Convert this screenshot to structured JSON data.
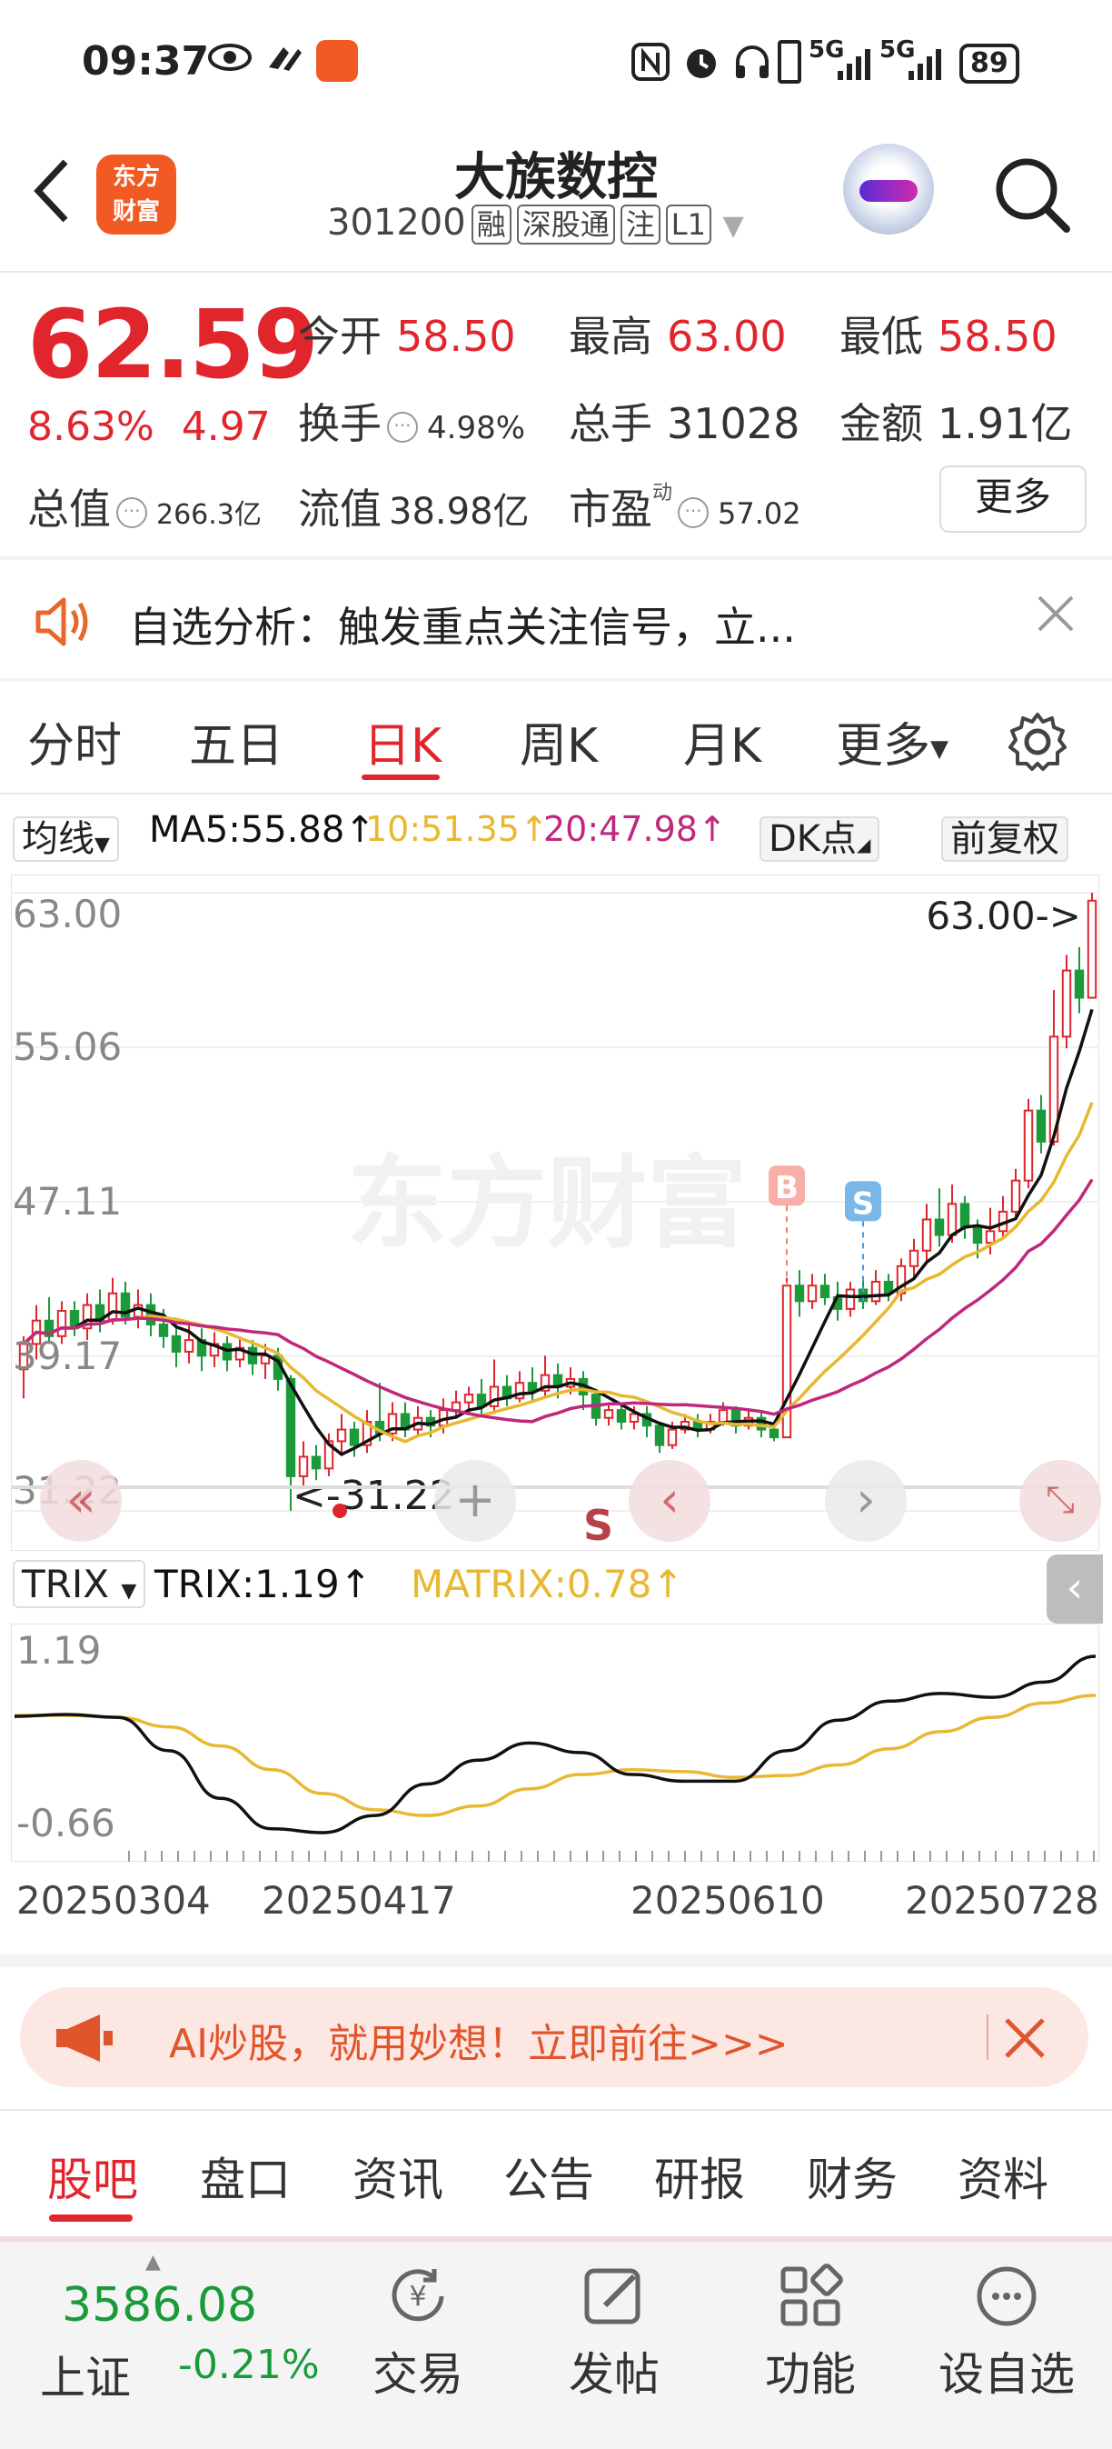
{
  "status_bar": {
    "time": "09:37",
    "network_1": "5G",
    "network_2": "5G",
    "battery": "89"
  },
  "header": {
    "title": "大族数控",
    "code": "301200",
    "tags": [
      "融",
      "深股通",
      "注",
      "L1"
    ],
    "logo_text_1": "东方",
    "logo_text_2": "财富"
  },
  "quote": {
    "price": "62.59",
    "change_pct": "8.63%",
    "change": "4.97",
    "rows": [
      [
        {
          "label": "今开",
          "value": "58.50",
          "color": "red"
        },
        {
          "label": "最高",
          "value": "63.00",
          "color": "red"
        },
        {
          "label": "最低",
          "value": "58.50",
          "color": "red"
        }
      ],
      [
        {
          "label": "换手",
          "value": "4.98%"
        },
        {
          "label": "总手",
          "value": "31028"
        },
        {
          "label": "金额",
          "value": "1.91亿"
        }
      ],
      [
        {
          "label": "总值",
          "value": "266.3亿"
        },
        {
          "label": "流值",
          "value": "38.98亿"
        },
        {
          "label": "市盈",
          "value": "57.02",
          "sup": "动"
        }
      ]
    ],
    "more": "更多"
  },
  "banner": {
    "text": "自选分析：触发重点关注信号，立..."
  },
  "tabs": [
    "分时",
    "五日",
    "日K",
    "周K",
    "月K",
    "更多",
    "⚙"
  ],
  "active_tab": "日K",
  "ma_bar": {
    "mode": "均线",
    "ma5": "MA5:55.88↑",
    "ma10": "10:51.35↑",
    "ma20": "20:47.98↑",
    "dk": "DK点",
    "adjust": "前复权"
  },
  "colors": {
    "up": "#e0262c",
    "down": "#1b9a3a",
    "ma5": "#111111",
    "ma10": "#e8b830",
    "ma20": "#c0287c",
    "trix": "#111111",
    "matrix": "#e8b830"
  },
  "kchart": {
    "y_ticks": [
      "63.00",
      "55.06",
      "47.11",
      "39.17",
      "31.22"
    ],
    "high_marker": "63.00->",
    "low_marker": "<-31.22",
    "buy_mark": "B",
    "sell_mark": "S",
    "s_label": "S",
    "watermark": "东方财富"
  },
  "trix_bar": {
    "mode": "TRIX",
    "trix": "TRIX:1.19↑",
    "matrix": "MATRIX:0.78↑"
  },
  "trix_axis": [
    "1.19",
    "-0.66"
  ],
  "x_dates": [
    "20250304",
    "20250417",
    "20250610",
    "20250728"
  ],
  "chart_data": [
    {
      "type": "candlestick",
      "title": "",
      "ylim": [
        31.22,
        63.0
      ],
      "high": 63.0,
      "low": 31.22,
      "candles": [
        [
          38.5,
          39.8,
          37.0,
          40.2
        ],
        [
          39.8,
          41.0,
          39.0,
          41.8
        ],
        [
          41.0,
          40.2,
          39.8,
          42.2
        ],
        [
          40.2,
          41.5,
          39.8,
          42.0
        ],
        [
          41.5,
          40.6,
          40.2,
          42.0
        ],
        [
          40.6,
          41.8,
          40.0,
          42.4
        ],
        [
          41.8,
          41.0,
          40.4,
          42.6
        ],
        [
          41.0,
          42.4,
          40.8,
          43.2
        ],
        [
          42.4,
          41.2,
          40.8,
          43.0
        ],
        [
          41.2,
          41.8,
          40.6,
          42.6
        ],
        [
          41.8,
          40.8,
          40.2,
          42.4
        ],
        [
          40.8,
          40.2,
          39.6,
          41.6
        ],
        [
          40.2,
          39.4,
          38.6,
          40.8
        ],
        [
          39.4,
          40.0,
          38.8,
          40.8
        ],
        [
          40.0,
          39.2,
          38.4,
          40.6
        ],
        [
          39.2,
          39.8,
          38.6,
          40.4
        ],
        [
          39.8,
          39.0,
          38.4,
          40.2
        ],
        [
          39.0,
          39.6,
          38.6,
          40.2
        ],
        [
          39.6,
          38.8,
          38.2,
          40.0
        ],
        [
          38.8,
          39.2,
          38.0,
          39.8
        ],
        [
          39.2,
          38.0,
          37.4,
          39.6
        ],
        [
          38.0,
          33.0,
          31.22,
          38.2
        ],
        [
          33.0,
          34.0,
          32.4,
          34.8
        ],
        [
          34.0,
          33.4,
          32.8,
          34.6
        ],
        [
          33.4,
          34.8,
          33.0,
          35.2
        ],
        [
          34.8,
          35.4,
          34.2,
          36.2
        ],
        [
          35.4,
          34.6,
          34.0,
          35.8
        ],
        [
          34.6,
          35.8,
          34.2,
          36.4
        ],
        [
          35.8,
          35.2,
          34.8,
          37.8
        ],
        [
          35.2,
          36.2,
          34.8,
          36.8
        ],
        [
          36.2,
          35.4,
          35.0,
          36.8
        ],
        [
          35.4,
          36.0,
          35.0,
          36.6
        ],
        [
          36.0,
          35.6,
          35.0,
          36.4
        ],
        [
          35.6,
          36.4,
          35.2,
          37.0
        ],
        [
          36.4,
          36.8,
          36.0,
          37.4
        ],
        [
          36.8,
          37.2,
          36.2,
          37.6
        ],
        [
          37.2,
          36.6,
          36.2,
          38.0
        ],
        [
          36.6,
          37.6,
          36.2,
          39.0
        ],
        [
          37.6,
          37.0,
          36.6,
          38.2
        ],
        [
          37.0,
          37.8,
          36.8,
          38.4
        ],
        [
          37.8,
          37.4,
          36.8,
          38.6
        ],
        [
          37.4,
          38.2,
          37.0,
          39.2
        ],
        [
          38.2,
          37.6,
          37.0,
          38.8
        ],
        [
          37.6,
          38.0,
          37.2,
          38.6
        ],
        [
          38.0,
          37.2,
          36.4,
          38.4
        ],
        [
          37.2,
          36.0,
          35.6,
          37.4
        ],
        [
          36.0,
          36.4,
          35.6,
          36.8
        ],
        [
          36.4,
          35.8,
          35.4,
          36.8
        ],
        [
          35.8,
          36.2,
          35.4,
          36.6
        ],
        [
          36.2,
          35.6,
          35.0,
          36.6
        ],
        [
          35.6,
          34.6,
          34.2,
          35.8
        ],
        [
          34.6,
          35.4,
          34.4,
          35.8
        ],
        [
          35.4,
          35.8,
          35.2,
          36.2
        ],
        [
          35.8,
          35.4,
          35.0,
          36.2
        ],
        [
          35.4,
          35.8,
          35.2,
          36.2
        ],
        [
          35.8,
          36.4,
          35.6,
          36.8
        ],
        [
          36.4,
          35.6,
          35.2,
          36.6
        ],
        [
          35.6,
          36.0,
          35.4,
          36.4
        ],
        [
          36.0,
          35.4,
          35.0,
          36.4
        ],
        [
          35.4,
          35.0,
          34.8,
          35.8
        ],
        [
          35.0,
          42.8,
          35.0,
          43.2
        ],
        [
          42.8,
          42.0,
          41.2,
          43.6
        ],
        [
          42.0,
          42.8,
          41.6,
          43.4
        ],
        [
          42.8,
          42.2,
          41.8,
          43.4
        ],
        [
          42.2,
          41.6,
          41.0,
          43.0
        ],
        [
          41.6,
          42.6,
          41.2,
          43.0
        ],
        [
          42.6,
          42.0,
          41.6,
          43.2
        ],
        [
          42.0,
          43.0,
          41.8,
          43.6
        ],
        [
          43.0,
          42.4,
          42.0,
          43.4
        ],
        [
          42.4,
          43.8,
          42.0,
          44.2
        ],
        [
          43.8,
          44.6,
          43.2,
          45.2
        ],
        [
          44.6,
          46.2,
          44.0,
          47.0
        ],
        [
          46.2,
          45.4,
          44.8,
          47.8
        ],
        [
          45.4,
          47.0,
          45.0,
          48.0
        ],
        [
          47.0,
          45.8,
          45.2,
          47.4
        ],
        [
          45.8,
          45.0,
          44.2,
          46.2
        ],
        [
          45.0,
          45.6,
          44.4,
          46.8
        ],
        [
          45.6,
          46.6,
          45.2,
          47.4
        ],
        [
          46.6,
          48.2,
          46.2,
          48.8
        ],
        [
          48.2,
          51.8,
          47.8,
          52.4
        ],
        [
          51.8,
          50.2,
          49.6,
          52.6
        ],
        [
          50.2,
          55.6,
          50.0,
          58.0
        ],
        [
          55.6,
          59.0,
          55.0,
          59.8
        ],
        [
          59.0,
          57.6,
          56.8,
          60.2
        ],
        [
          57.6,
          62.59,
          58.5,
          63.0
        ]
      ],
      "candle_format": [
        "open",
        "close",
        "low",
        "high"
      ],
      "series": [
        {
          "name": "MA5",
          "current": 55.88
        },
        {
          "name": "MA10",
          "current": 51.35
        },
        {
          "name": "MA20",
          "current": 47.98
        }
      ]
    },
    {
      "type": "line",
      "title": "",
      "ylim": [
        -0.66,
        1.19
      ],
      "x": [
        "20250304",
        "20250417",
        "20250610",
        "20250728"
      ],
      "series": [
        {
          "name": "TRIX",
          "values": [
            0.56,
            0.58,
            0.55,
            0.2,
            -0.3,
            -0.62,
            -0.66,
            -0.48,
            -0.15,
            0.1,
            0.28,
            0.18,
            -0.05,
            -0.12,
            -0.12,
            0.2,
            0.52,
            0.72,
            0.8,
            0.76,
            0.92,
            1.19
          ]
        },
        {
          "name": "MATRIX",
          "values": [
            0.57,
            0.57,
            0.55,
            0.45,
            0.25,
            0.0,
            -0.25,
            -0.42,
            -0.48,
            -0.38,
            -0.2,
            -0.05,
            0.0,
            -0.02,
            -0.08,
            -0.06,
            0.05,
            0.22,
            0.4,
            0.55,
            0.7,
            0.78
          ]
        }
      ]
    }
  ],
  "ai_banner": {
    "text": "AI炒股，就用妙想！立即前往>>>"
  },
  "bottom_tabs": [
    "股吧",
    "盘口",
    "资讯",
    "公告",
    "研报",
    "财务",
    "资料"
  ],
  "footer": {
    "index_value": "3586.08",
    "index_name": "上证",
    "index_change": "-0.21%",
    "buttons": [
      "交易",
      "发帖",
      "功能",
      "设自选"
    ]
  }
}
